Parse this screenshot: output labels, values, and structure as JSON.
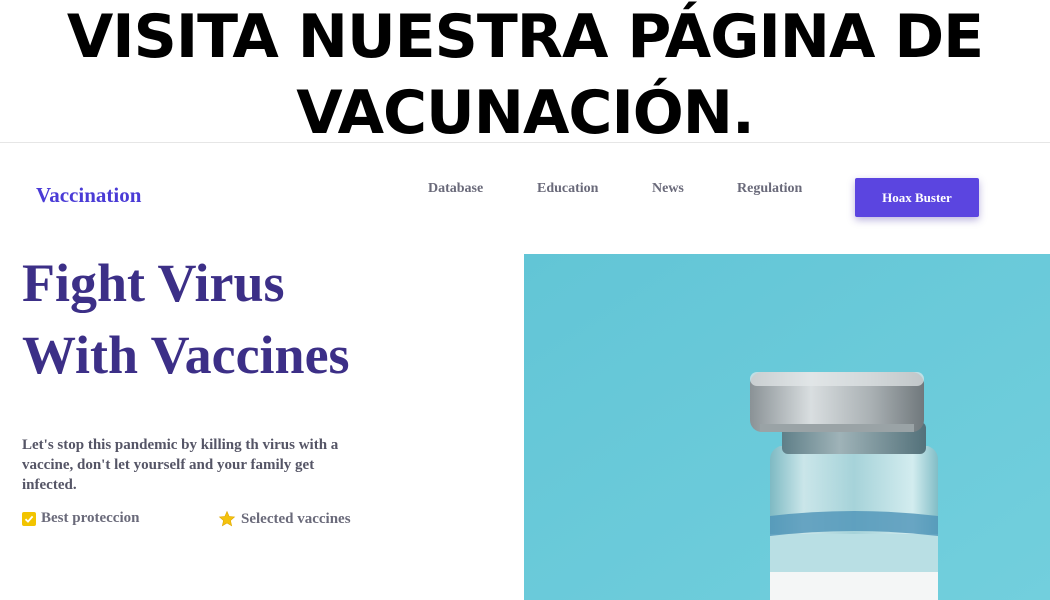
{
  "banner": {
    "line1": "VISITA NUESTRA PÁGINA DE",
    "line2": "VACUNACIÓN."
  },
  "header": {
    "logo": "Vaccination",
    "nav": [
      "Database",
      "Education",
      "News",
      "Regulation"
    ],
    "cta_label": "Hoax Buster"
  },
  "hero": {
    "title_line1": "Fight Virus",
    "title_line2": "With Vaccines",
    "description": "Let's stop this pandemic by killing th virus with a vaccine, don't let yourself and your family get infected.",
    "features": [
      {
        "label": "Best proteccion",
        "icon": "checkbox-icon"
      },
      {
        "label": "Selected vaccines",
        "icon": "star-icon"
      }
    ]
  },
  "colors": {
    "brand": "#4a3bd6",
    "title": "#3c2f87",
    "cta": "#5b45e0",
    "image_bg": "#6cc9d9"
  }
}
